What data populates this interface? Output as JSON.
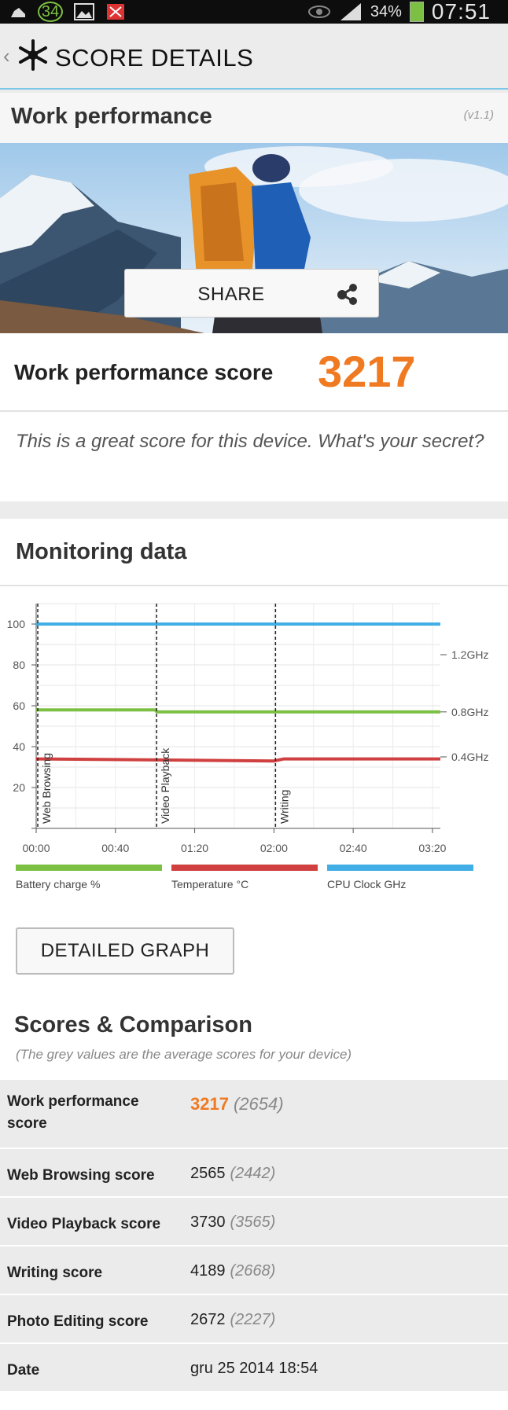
{
  "status_bar": {
    "notification_count": "34",
    "battery": "34%",
    "time": "07:51"
  },
  "action_bar": {
    "back": "‹",
    "title": "SCORE DETAILS"
  },
  "work_performance": {
    "title": "Work performance",
    "version": "(v1.1)",
    "share_label": "SHARE",
    "score_label": "Work performance score",
    "score_value": "3217",
    "message": "This is a great score for this device. What's your secret?"
  },
  "monitoring": {
    "title": "Monitoring data",
    "detailed_graph_label": "DETAILED GRAPH"
  },
  "chart_data": {
    "type": "line",
    "x_ticks": [
      "00:00",
      "00:40",
      "01:20",
      "02:00",
      "02:40",
      "03:20"
    ],
    "y_ticks": [
      100,
      80,
      60,
      40,
      20
    ],
    "y_range": [
      0,
      110
    ],
    "right_ticks": [
      "1.2GHz",
      "0.8GHz",
      "0.4GHz"
    ],
    "phases": [
      {
        "label": "Web Browsing",
        "start_min": 0
      },
      {
        "label": "Video Playback",
        "start_min": 60
      },
      {
        "label": "Writing",
        "start_min": 120
      }
    ],
    "x_range_min": [
      0,
      204
    ],
    "series": [
      {
        "name": "Battery charge %",
        "color": "#7cc043",
        "points": [
          [
            0,
            58
          ],
          [
            60,
            58
          ],
          [
            61,
            57
          ],
          [
            204,
            57
          ]
        ]
      },
      {
        "name": "Temperature °C",
        "color": "#d04040",
        "points": [
          [
            0,
            34
          ],
          [
            120,
            33
          ],
          [
            125,
            34
          ],
          [
            204,
            34
          ]
        ]
      },
      {
        "name": "CPU Clock GHz",
        "color": "#41aee6",
        "points": [
          [
            0,
            100
          ],
          [
            204,
            100
          ]
        ]
      }
    ],
    "grid": true
  },
  "comparison": {
    "title": "Scores & Comparison",
    "subtitle": "(The grey values are the average scores for your device)",
    "rows": [
      {
        "label": "Work performance score",
        "value": "3217",
        "avg": "(2654)"
      },
      {
        "label": "Web Browsing score",
        "value": "2565",
        "avg": "(2442)"
      },
      {
        "label": "Video Playback score",
        "value": "3730",
        "avg": "(3565)"
      },
      {
        "label": "Writing score",
        "value": "4189",
        "avg": "(2668)"
      },
      {
        "label": "Photo Editing score",
        "value": "2672",
        "avg": "(2227)"
      },
      {
        "label": "Date",
        "value": "gru 25 2014 18:54",
        "avg": ""
      }
    ]
  }
}
